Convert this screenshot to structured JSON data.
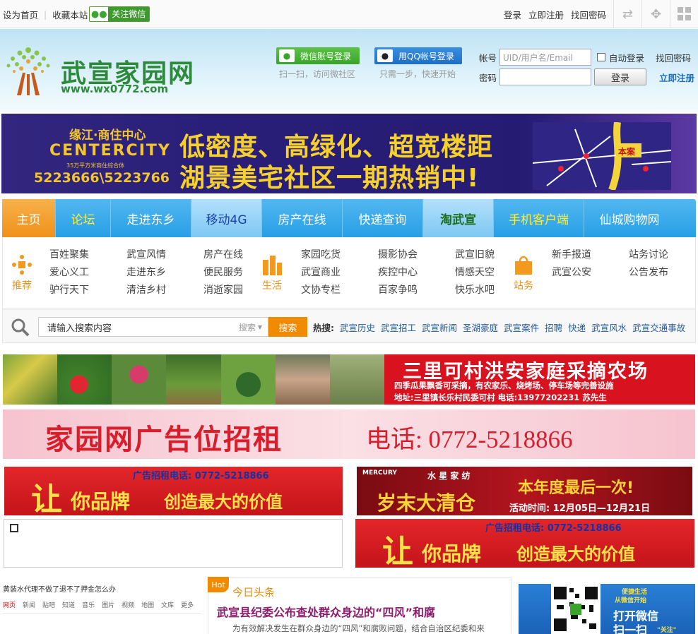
{
  "topbar": {
    "set_home": "设为首页",
    "bookmark": "收藏本站",
    "follow_wechat": "关注微信",
    "login": "登录",
    "register": "立即注册",
    "find_password": "找回密码"
  },
  "header": {
    "site_name": "武宣家园网",
    "site_url": "www.wx0772.com",
    "wechat_login": "微信账号登录",
    "wechat_hint": "扫一扫，访问微社区",
    "qq_login": "用QQ帐号登录",
    "qq_hint": "只需一步，快速开始",
    "account_label": "帐号",
    "account_placeholder": "UID/用户名/Email",
    "auto_login": "自动登录",
    "find_password": "找回密码",
    "password_label": "密码",
    "login_button": "登录",
    "register_link": "立即注册"
  },
  "banner_top": {
    "brand_cn": "缘江·商住中心",
    "brand_en": "CENTERCITY",
    "brand_sub": "35万平方米商住综合体",
    "phone": "5223666\\5223766",
    "slogan_1": "低密度、高绿化、超宽楼距",
    "slogan_2": "湖景美宅社区一期热销中!",
    "map_label": "本案"
  },
  "nav": {
    "items": [
      "主页",
      "论坛",
      "走进东乡",
      "移动4G",
      "房产在线",
      "快递查询",
      "淘武宣",
      "手机客户端",
      "仙城购物网"
    ]
  },
  "subnav": {
    "groups": [
      {
        "icon_label": "推荐",
        "columns": [
          [
            "百姓聚集",
            "爱心义工",
            "驴行天下"
          ],
          [
            "武宣风情",
            "走进东乡",
            "清洁乡村"
          ],
          [
            "房产在线",
            "便民服务",
            "消逝家园"
          ]
        ]
      },
      {
        "icon_label": "生活",
        "columns": [
          [
            "家园吃货",
            "武宣商业",
            "文协专栏"
          ],
          [
            "摄影协会",
            "疾控中心",
            "百家争鸣"
          ],
          [
            "武宣旧貌",
            "情感天空",
            "快乐水吧"
          ]
        ]
      },
      {
        "icon_label": "站务",
        "columns": [
          [
            "新手报道",
            "武宣公安"
          ],
          [
            "站务讨论",
            "公告发布"
          ]
        ]
      }
    ]
  },
  "search": {
    "placeholder": "请输入搜索内容",
    "select_label": "搜索",
    "button": "搜索",
    "hot_label": "热搜:",
    "hot_items": [
      "武宣历史",
      "武宣招工",
      "武宣新闻",
      "圣湖豪庭",
      "武宣案件",
      "招聘",
      "快递",
      "武宣风水",
      "武宣交通事故"
    ]
  },
  "ads": {
    "farm_title": "三里可村洪安家庭采摘农场",
    "farm_line1": "四季瓜果飘香可采摘，有农家乐、烧烤场、停车场等完善设施",
    "farm_line2": "地址:三里镇长乐村民委可村  电话:13977202231 苏先生",
    "rent_title": "家园网广告位招租",
    "rent_phone": "电话: 0772-5218866",
    "brand_phone": "广告招租电话: 0772-5218866",
    "brand_slogan_1": "让",
    "brand_slogan_2": "你品牌",
    "brand_slogan_3": "创造最大的价值",
    "sx_brand": "水 星 家 纺",
    "sx_big": "岁末大清仓",
    "sx_last": "本年度最后一次!",
    "sx_time": "活动时间: 12月05日—12月21日"
  },
  "bottom": {
    "screenshot_title": "黄装水代理不做了退不了押金怎么办",
    "screenshot_tabs": [
      "网页",
      "新闻",
      "贴吧",
      "知道",
      "音乐",
      "图片",
      "视频",
      "地图",
      "文库",
      "更多"
    ],
    "hot_tag": "Hot",
    "today_headline": "今日头条",
    "headline": "武宣县纪委公布查处群众身边的“四风”和腐",
    "summary": "为有效解决发生在群众身边的“四风”和腐败问题，结合自治区纪委和来",
    "qr_text_1": "便捷生活",
    "qr_text_2": "从微信开始",
    "qr_text_3": "打开微信",
    "qr_text_4": "扫一扫",
    "qr_text_5": "\"关注\""
  },
  "colors": {
    "nav_blue": "#279fe6",
    "nav_active": "#f39a1e",
    "brand_green": "#2d8a3a",
    "search_orange": "#f08b00",
    "link_blue": "#225b9e"
  }
}
